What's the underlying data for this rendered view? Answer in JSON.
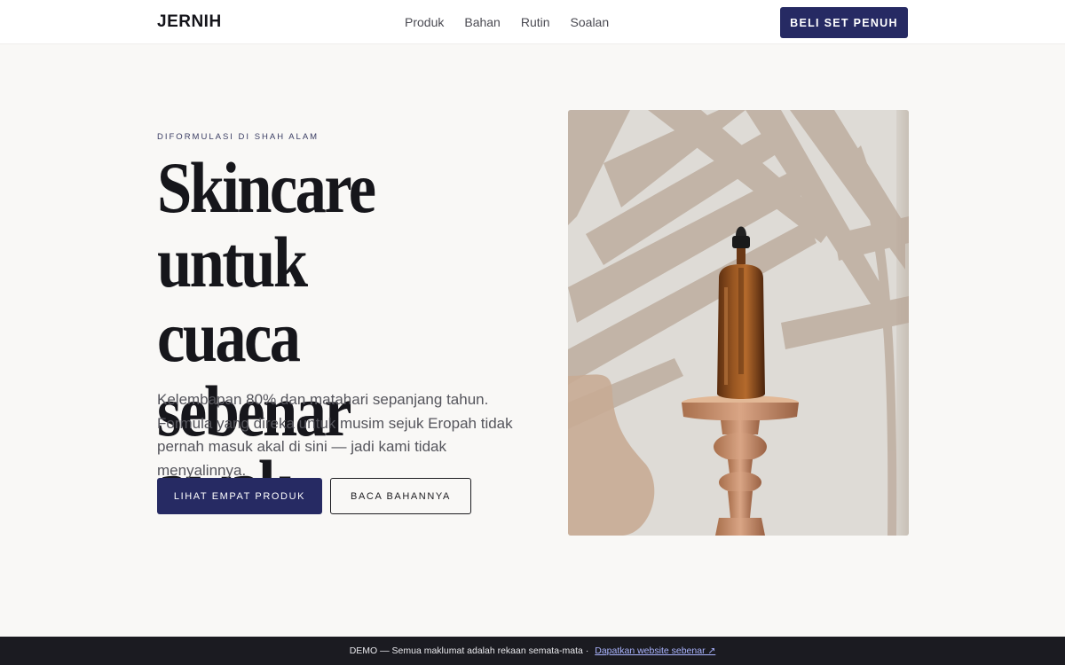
{
  "header": {
    "brand": "JERNIH",
    "nav": [
      "Produk",
      "Bahan",
      "Rutin",
      "Soalan"
    ],
    "cta_label": "BELI SET PENUH"
  },
  "hero": {
    "eyebrow": "DIFORMULASI DI SHAH ALAM",
    "headline_lines": [
      "Skincare untuk",
      "cuaca sebenar",
      "awak."
    ],
    "lede": "Kelembapan 80% dan matahari sepanjang tahun. Formula yang direka untuk musim sejuk Eropah tidak pernah masuk akal di sini — jadi kami tidak menyalinnya.",
    "primary_label": "LIHAT EMPAT PRODUK",
    "secondary_label": "BACA BAHANNYA"
  },
  "footer": {
    "demo_text": "DEMO — Semua maklumat adalah rekaan semata-mata ·",
    "demo_link": "Dapatkan website sebenar ↗"
  },
  "colors": {
    "accent": "#262a63",
    "background": "#f9f8f6",
    "footer_bg": "#1b1b21"
  },
  "icons": [
    "dropper-bottle-image",
    "external-link-icon"
  ]
}
